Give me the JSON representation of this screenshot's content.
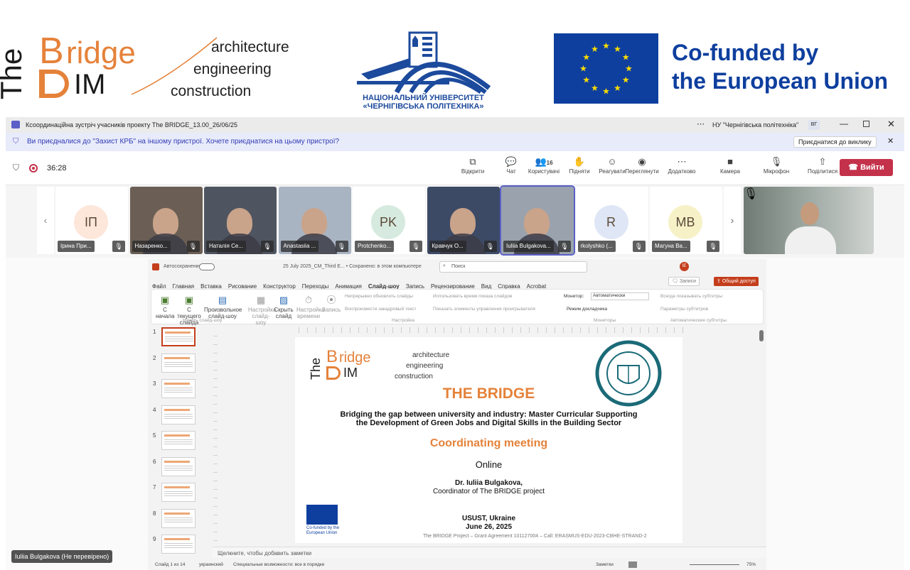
{
  "banner": {
    "bridge_logo": {
      "the": "The",
      "ridge": "ridge",
      "b": "B",
      "im": "IM",
      "tag1": "architecture",
      "tag2": "engineering",
      "tag3": "construction"
    },
    "university": {
      "line1": "НАЦІОНАЛЬНИЙ УНІВЕРСИТЕТ",
      "line2": "«ЧЕРНІГІВСЬКА ПОЛІТЕХНІКА»"
    },
    "eu": {
      "line1": "Co-funded by",
      "line2": "the European Union"
    }
  },
  "teams": {
    "window_title": "Ксоординаційна зустріч учасників проекту The BRIDGE_13.00_26/06/25",
    "org_name": "НУ \"Чернігівська політехніка\"",
    "org_badge": "ВГ",
    "notice_text": "Ви приєдналися до \"Захист КРБ\" на іншому пристрої. Хочете приєднатися на цьому пристрої?",
    "notice_button": "Приєднатися до виклику",
    "timer": "36:28",
    "toolbar": [
      {
        "icon": "open-icon",
        "label": "Відкрити"
      },
      {
        "icon": "chat-icon",
        "label": "Чат"
      },
      {
        "icon": "people-icon",
        "label": "Користувачі",
        "count": "16"
      },
      {
        "icon": "raise-hand-icon",
        "label": "Підняти"
      },
      {
        "icon": "react-icon",
        "label": "Реагувати"
      },
      {
        "icon": "view-icon",
        "label": "Переглянути"
      },
      {
        "icon": "more-icon",
        "label": "Додатково"
      },
      {
        "icon": "camera-icon",
        "label": "Камера"
      },
      {
        "icon": "microphone-icon",
        "label": "Мікрофон"
      },
      {
        "icon": "share-icon",
        "label": "Поділитися"
      }
    ],
    "leave_label": "Вийти",
    "participants": [
      {
        "initials": "ІП",
        "name": "Ірина При...",
        "bg": "#fde7da",
        "type": "avatar"
      },
      {
        "initials": "",
        "name": "Назаренко...",
        "bg": "#6b5f55",
        "type": "video"
      },
      {
        "initials": "",
        "name": "Наталія Се...",
        "bg": "#4f5560",
        "type": "video"
      },
      {
        "initials": "",
        "name": "Anastasiia ...",
        "bg": "#a9b4c2",
        "type": "video"
      },
      {
        "initials": "PK",
        "name": "Protchenko...",
        "bg": "#d6eadf",
        "type": "avatar"
      },
      {
        "initials": "",
        "name": "Кравчук О...",
        "bg": "#3c4a66",
        "type": "video"
      },
      {
        "initials": "",
        "name": "Iuliia Bulgakova...",
        "bg": "#9aa3ad",
        "type": "video"
      },
      {
        "initials": "R",
        "name": "rkolyshko (...",
        "bg": "#dfe6f5",
        "type": "avatar"
      },
      {
        "initials": "МВ",
        "name": "Магуна Ва...",
        "bg": "#f7f1c8",
        "type": "avatar"
      }
    ],
    "presenter_label": "Iuliia Bulgakova (Не перевірено)"
  },
  "ppt": {
    "autosave": "Автосохранение",
    "file_name": "25 July 2025_CM_Third E... • Сохранено: в этом компьютере",
    "search_placeholder": "Поиск",
    "user_badge": "IE",
    "comments_label": "Записи",
    "share_label": "Общий доступ",
    "tabs": [
      "Файл",
      "Главная",
      "Вставка",
      "Рисование",
      "Конструктор",
      "Переходы",
      "Анимация",
      "Слайд-шоу",
      "Запись",
      "Рецензирование",
      "Вид",
      "Справка",
      "Acrobat"
    ],
    "active_tab": "Слайд-шоу",
    "ribbon": {
      "from_start": "С начала",
      "from_current": "С текущего слайда",
      "custom_show": "Произвольное слайд-шоу",
      "setup_show": "Настройка слайд-шоу",
      "hide_slide": "Скрыть слайд",
      "rehearse": "Настройка времени",
      "record": "Запись",
      "opt1": "Непрерывно обновлять слайды",
      "opt2": "Воспроизвести закадровый текст",
      "opt3": "Использовать время показа слайдов",
      "opt4": "Показать элементы управления проигрывателя",
      "monitor_label": "Монитор:",
      "monitor_value": "Автоматически",
      "presenter_mode": "Режим докладчика",
      "always_subtitles": "Всегда показывать субтитры",
      "subtitle_settings": "Параметры субтитров",
      "group1": "Начать слайд-шоу",
      "group2": "Настройка",
      "group3": "Мониторы",
      "group4": "Автоматические субтитры"
    },
    "slide_numbers": [
      "1",
      "2",
      "3",
      "4",
      "5",
      "6",
      "7",
      "8",
      "9"
    ],
    "notes_placeholder": "Щелкните, чтобы добавить заметки",
    "status_left": "Слайд 1 из 14",
    "status_lang": "украинский",
    "status_access": "Специальные возможности: все в порядке",
    "status_notes": "Заметки",
    "zoom": "75%",
    "slide": {
      "logo_the": "The",
      "logo_ridge": "ridge",
      "logo_b": "B",
      "logo_im": "IM",
      "tag1": "architecture",
      "tag2": "engineering",
      "tag3": "construction",
      "title": "THE BRIDGE",
      "subtitle1": "Bridging the gap between university and industry: Master Curricular Supporting",
      "subtitle2": "the Development of Green Jobs and Digital Skills in the Building Sector",
      "meeting": "Coordinating meeting",
      "mode": "Online",
      "coordinator_name": "Dr. Iuliia Bulgakova,",
      "coordinator_role": "Coordinator of The BRIDGE project",
      "eu_small": "Co-funded by the European Union",
      "place": "USUST, Ukraine",
      "date": "June 26, 2025",
      "footer": "The BRIDGE Project – Grant Agreement 101127004 – Call: ERASMUS-EDU-2023-CBHE-STRAND-2"
    }
  },
  "colors": {
    "orange": "#e5823a",
    "eu_blue": "#0e3f9e",
    "uni_blue": "#1c4a9c",
    "leave_red": "#c4314b",
    "ppt_red": "#c43e1c"
  }
}
